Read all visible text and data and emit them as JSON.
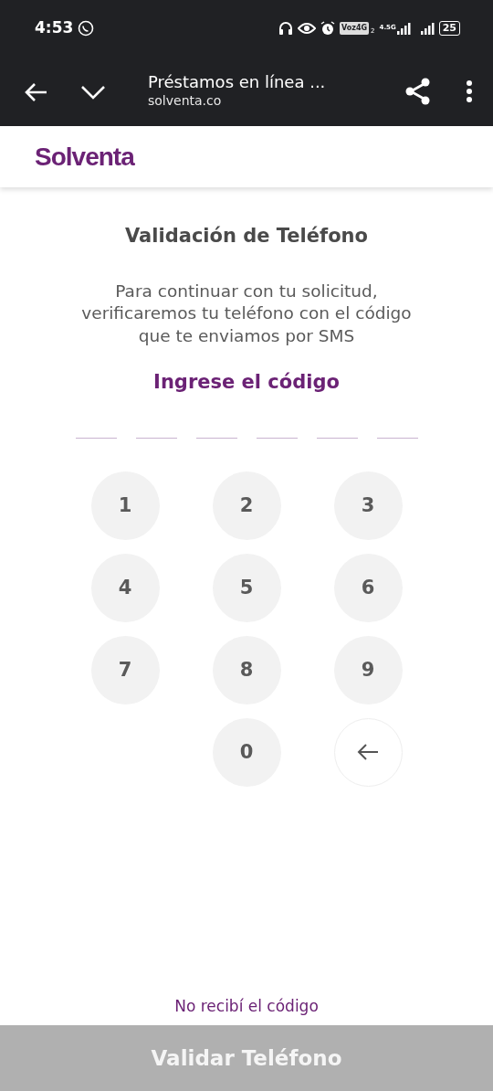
{
  "status_bar": {
    "time": "4:53",
    "network_badge": "Voz4G",
    "sim_number": "2",
    "network_type": "4.5G",
    "battery": "25"
  },
  "browser_bar": {
    "title": "Préstamos en línea ...",
    "url": "solventa.co"
  },
  "site_header": {
    "logo": "Solventa"
  },
  "title": "Validación de Teléfono",
  "description": "Para continuar con tu solicitud, verificaremos tu teléfono con el código que te enviamos por SMS",
  "code_prompt": "Ingrese el código",
  "code_slots": [
    {
      "kind": "slot"
    },
    {
      "kind": "slot"
    },
    {
      "kind": "slot"
    },
    {
      "kind": "slot"
    },
    {
      "kind": "slot"
    },
    {
      "kind": "slot"
    }
  ],
  "keypad": [
    {
      "kind": "digit",
      "label": "1"
    },
    {
      "kind": "digit",
      "label": "2"
    },
    {
      "kind": "digit",
      "label": "3"
    },
    {
      "kind": "digit",
      "label": "4"
    },
    {
      "kind": "digit",
      "label": "5"
    },
    {
      "kind": "digit",
      "label": "6"
    },
    {
      "kind": "digit",
      "label": "7"
    },
    {
      "kind": "digit",
      "label": "8"
    },
    {
      "kind": "digit",
      "label": "9"
    },
    {
      "kind": "empty"
    },
    {
      "kind": "digit",
      "label": "0"
    },
    {
      "kind": "backspace"
    }
  ],
  "resend_link": "No recibí el código",
  "submit_button": {
    "label": "Validar Teléfono",
    "disabled": true
  }
}
